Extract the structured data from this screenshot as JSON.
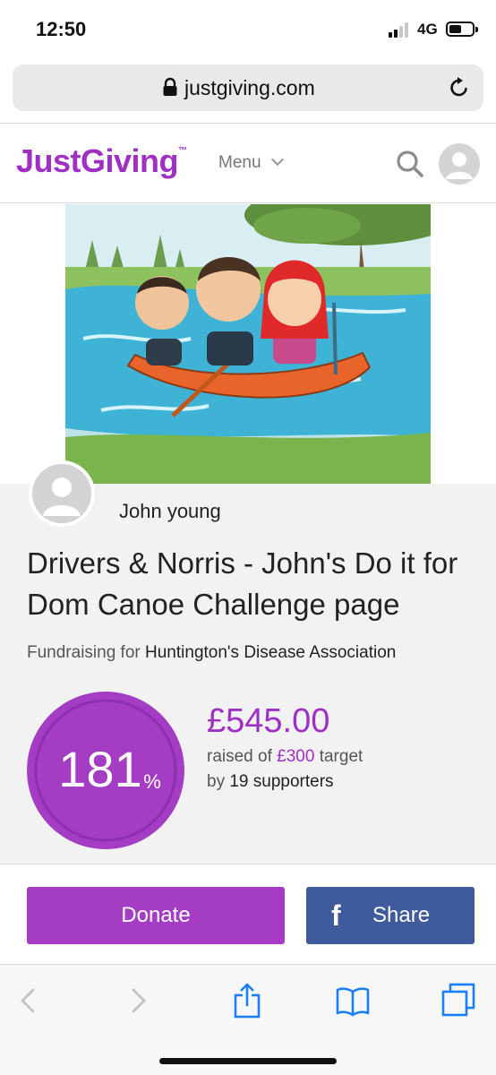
{
  "status_bar": {
    "time": "12:50",
    "network": "4G"
  },
  "browser": {
    "url": "justgiving.com"
  },
  "header": {
    "logo_text": "JustGiving",
    "logo_tm": "™",
    "menu_label": "Menu"
  },
  "fundraiser": {
    "owner_name": "John young",
    "title": "Drivers & Norris - John's Do it for Dom Canoe Challenge page",
    "fundraising_prefix": "Fundraising for ",
    "charity": "Huntington's Disease Association",
    "percent": "181",
    "percent_sign": "%",
    "progress_fraction": 1.81,
    "raised_amount": "£545.00",
    "raised_prefix": "raised of ",
    "target": "£300",
    "target_suffix": " target",
    "supporters_prefix": "by ",
    "supporters": "19 supporters"
  },
  "actions": {
    "donate_label": "Donate",
    "share_label": "Share",
    "share_icon_glyph": "f"
  },
  "colors": {
    "brand_purple": "#a02fc4",
    "donate_purple": "#a43cc4",
    "facebook_blue": "#3f5b9c",
    "safari_blue": "#1a7ff5"
  },
  "icons": [
    "lock-icon",
    "reload-icon",
    "search-icon",
    "user-avatar-icon",
    "facebook-icon",
    "back-icon",
    "forward-icon",
    "share-icon",
    "bookmarks-icon",
    "tabs-icon"
  ]
}
